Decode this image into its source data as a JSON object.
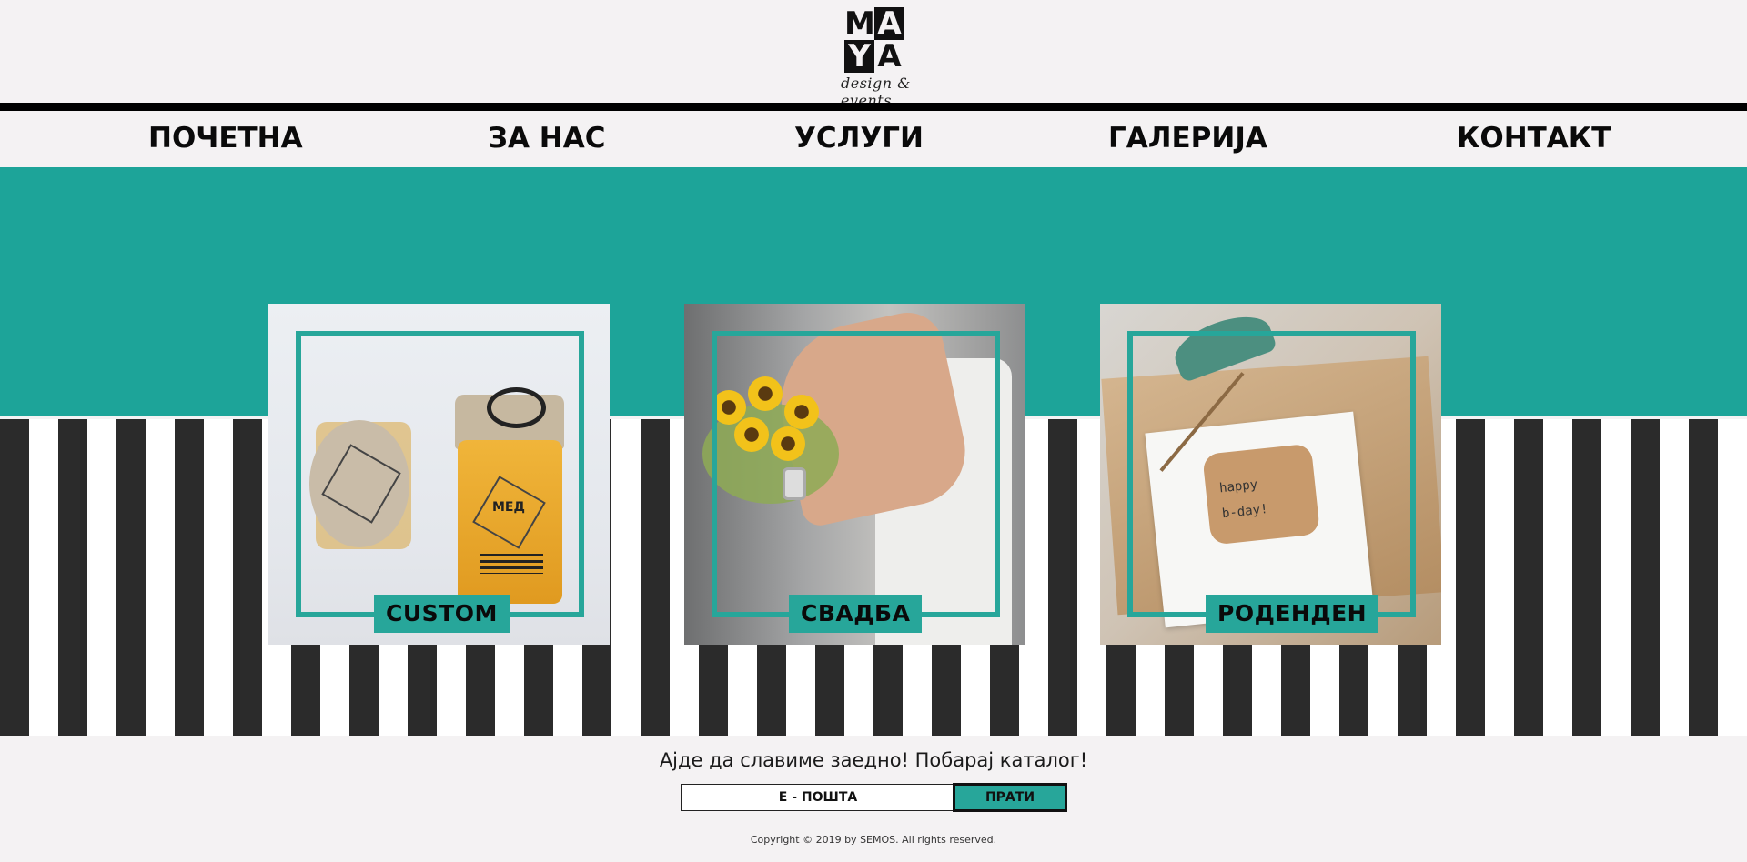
{
  "logo": {
    "letters": [
      "M",
      "A",
      "Y",
      "A"
    ],
    "tagline": "design & events"
  },
  "nav": [
    {
      "label": "ПОЧЕТНА"
    },
    {
      "label": "ЗА НАС"
    },
    {
      "label": "УСЛУГИ"
    },
    {
      "label": "ГАЛЕРИЈА"
    },
    {
      "label": "КОНТАКТ"
    }
  ],
  "cards": [
    {
      "label": "CUSTOM"
    },
    {
      "label": "СВАДБА"
    },
    {
      "label": "РОДЕНДЕН"
    }
  ],
  "card1_images": {
    "jar_label": "МЕД"
  },
  "card3_images": {
    "card_text_1": "happy",
    "card_text_2": "b-day!"
  },
  "footer": {
    "tagline": "Ајде да славиме заедно! Побарај каталог!",
    "email_placeholder": "Е - ПОШТА",
    "send_label": "ПРАТИ",
    "copyright": "Copyright © 2019 by SEMOS. All rights reserved."
  },
  "colors": {
    "accent": "#1da499",
    "stripe_dark": "#2b2b2b",
    "stripe_light": "#ffffff",
    "background": "#f4f2f3"
  }
}
